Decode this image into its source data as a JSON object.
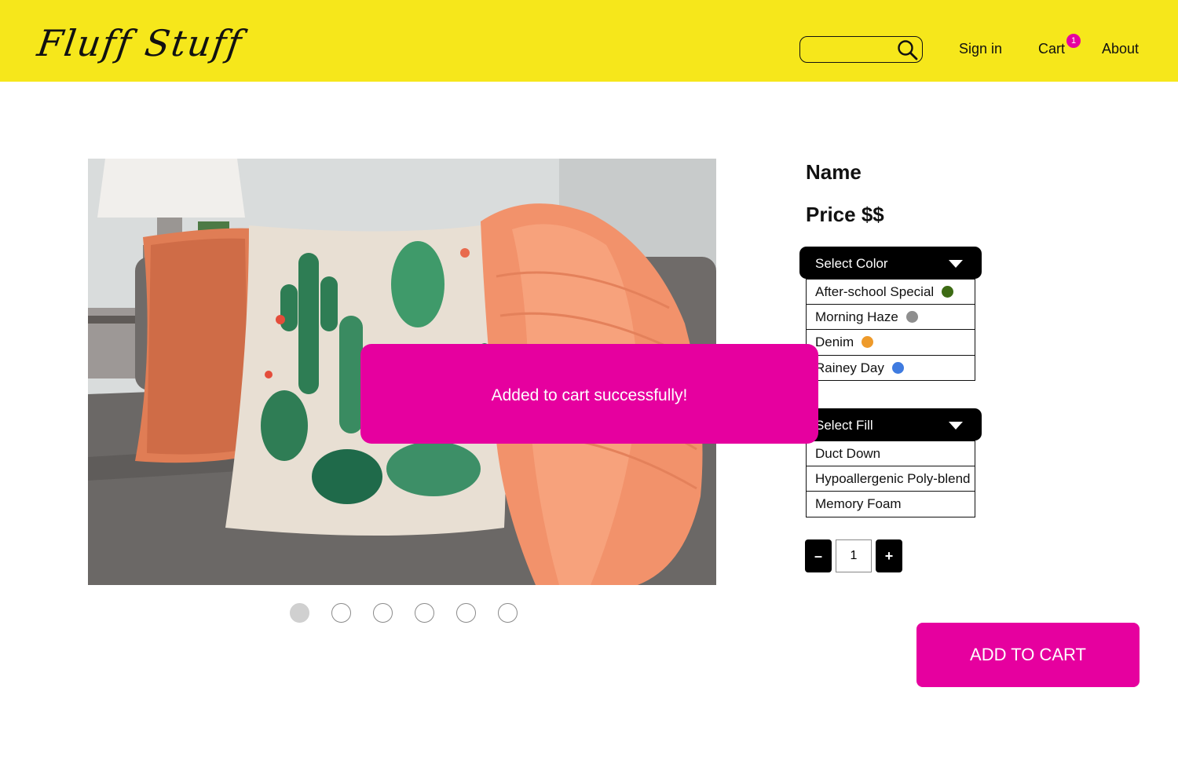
{
  "header": {
    "logo": "Fluff Stuff",
    "search": {
      "value": "",
      "placeholder": ""
    },
    "nav": {
      "sign_in": "Sign in",
      "cart": "Cart",
      "cart_count": "1",
      "about": "About"
    }
  },
  "product": {
    "name": "Name",
    "price": "Price $$",
    "carousel": {
      "total": 6,
      "active_index": 0
    }
  },
  "color_select": {
    "label": "Select Color",
    "options": [
      {
        "label": "After-school Special",
        "color": "#3d6b14"
      },
      {
        "label": "Morning Haze",
        "color": "#8e8e8e"
      },
      {
        "label": "Denim",
        "color": "#ee9a2a"
      },
      {
        "label": "Rainey Day",
        "color": "#3f7be0"
      }
    ]
  },
  "fill_select": {
    "label": "Select Fill",
    "options": [
      {
        "label": "Duct Down"
      },
      {
        "label": "Hypoallergenic Poly-blend"
      },
      {
        "label": "Memory Foam"
      }
    ]
  },
  "quantity": {
    "minus": "–",
    "value": "1",
    "plus": "+"
  },
  "add_to_cart": "ADD TO CART",
  "toast": "Added to cart successfully!",
  "colors": {
    "header_bg": "#f6e71b",
    "accent": "#e6009f"
  }
}
